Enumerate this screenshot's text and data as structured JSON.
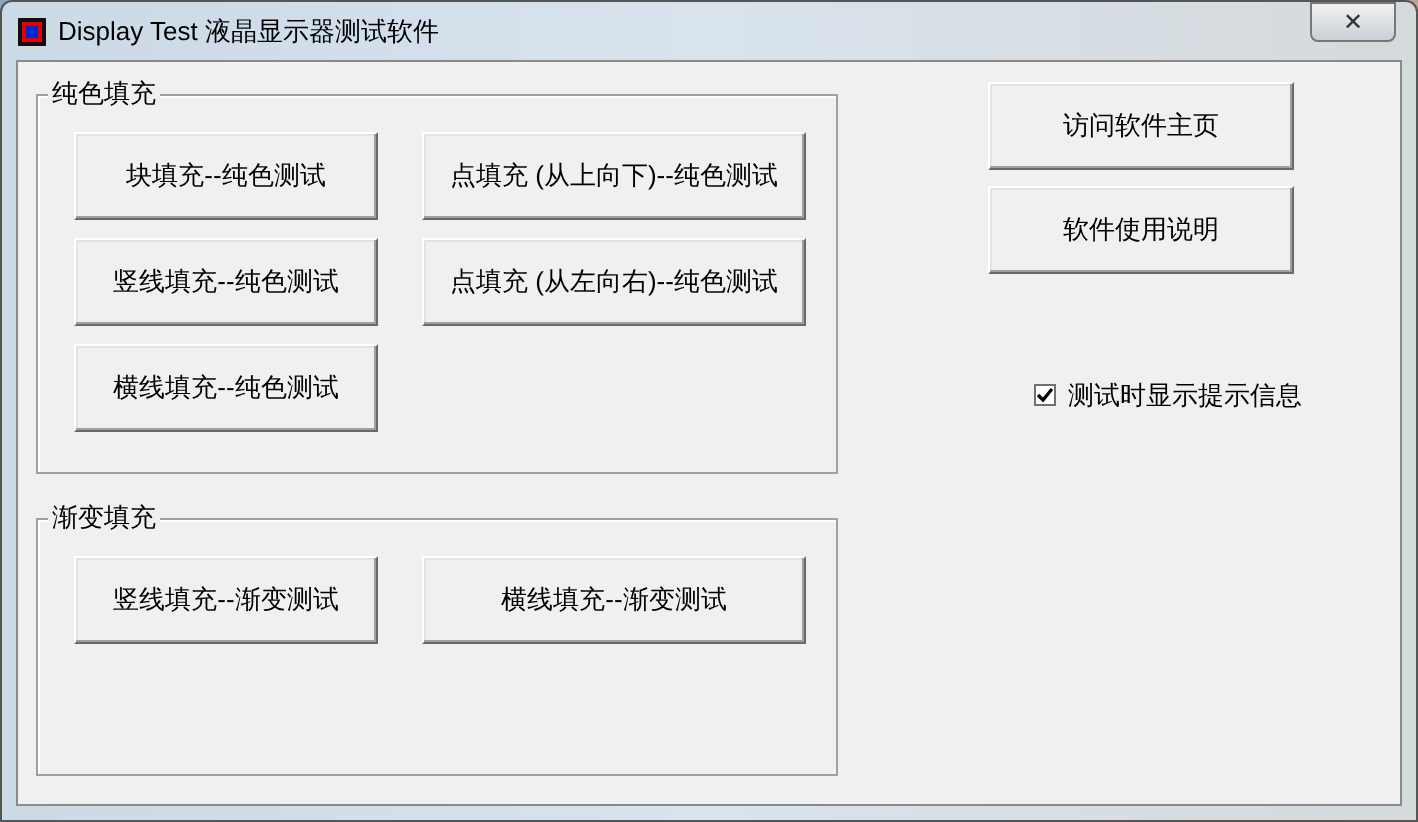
{
  "window": {
    "title": "Display Test 液晶显示器测试软件",
    "close": "✕"
  },
  "groups": [
    {
      "title": "纯色填充",
      "buttons": [
        "块填充--纯色测试",
        "点填充 (从上向下)--纯色测试",
        "竖线填充--纯色测试",
        "点填充 (从左向右)--纯色测试",
        "横线填充--纯色测试"
      ]
    },
    {
      "title": "渐变填充",
      "buttons": [
        "竖线填充--渐变测试",
        "横线填充--渐变测试"
      ]
    }
  ],
  "side_buttons": [
    "访问软件主页",
    "软件使用说明"
  ],
  "checkbox": {
    "label": "测试时显示提示信息",
    "checked": true
  }
}
